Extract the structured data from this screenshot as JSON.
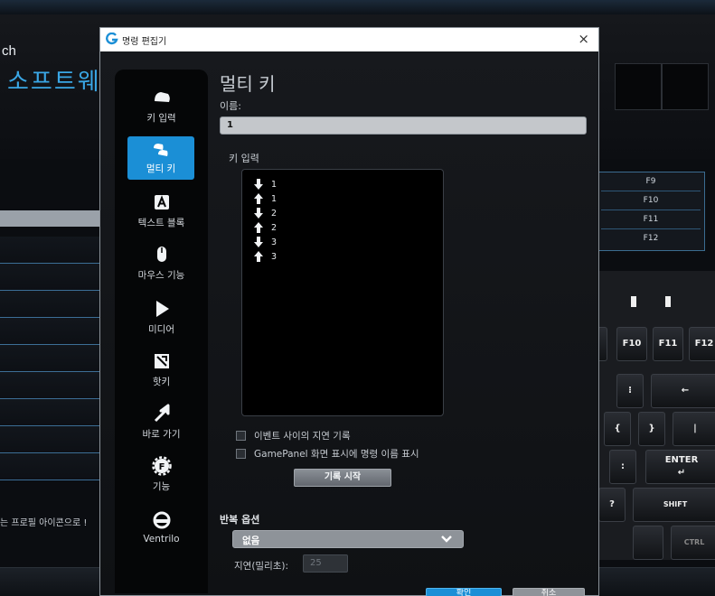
{
  "background": {
    "brand": "ch",
    "title": "소프트웨",
    "left_note": "는 프로필 아이콘으로 !",
    "fkeys": [
      "F9",
      "F10",
      "F11",
      "F12"
    ],
    "keyboard_labels": {
      "f10": "F10",
      "f11": "F11",
      "f12": "F12",
      "backspace_arrow": "←",
      "enter": "ENTER",
      "enter_arrow": "↵",
      "shift": "SHIFT",
      "ctrl": "CTRL",
      "colon": ":",
      "brace_open": "{",
      "brace_close": "}",
      "pipe": "|",
      "question": "?",
      "dots": "⁝"
    }
  },
  "dialog": {
    "title": "명령 편집기",
    "close": "×",
    "nav": [
      {
        "label": "키 입력",
        "icon": "key-icon"
      },
      {
        "label": "멀티 키",
        "icon": "multi-key-icon",
        "active": true
      },
      {
        "label": "텍스트 블록",
        "icon": "text-block-icon"
      },
      {
        "label": "마우스 기능",
        "icon": "mouse-icon"
      },
      {
        "label": "미디어",
        "icon": "play-icon"
      },
      {
        "label": "핫키",
        "icon": "hotkey-icon"
      },
      {
        "label": "바로 가기",
        "icon": "shortcut-arrow-icon"
      },
      {
        "label": "기능",
        "icon": "function-gear-icon"
      },
      {
        "label": "Ventrilo",
        "icon": "ventrilo-headset-icon"
      }
    ],
    "heading": "멀티 키",
    "name_label": "이름:",
    "name_value": "1",
    "keys_label": "키 입력",
    "key_events": [
      {
        "dir": "down",
        "key": "1"
      },
      {
        "dir": "up",
        "key": "1"
      },
      {
        "dir": "down",
        "key": "2"
      },
      {
        "dir": "up",
        "key": "2"
      },
      {
        "dir": "down",
        "key": "3"
      },
      {
        "dir": "up",
        "key": "3"
      }
    ],
    "check_delay": "이벤트 사이의 지연 기록",
    "check_gamepanel": "GamePanel 화면 표시에 명령 이름 표시",
    "record_button": "기록 시작",
    "repeat_label": "반복 옵션",
    "repeat_value": "없음",
    "delay_label": "지연(밀리초):",
    "delay_value": "25",
    "ok_button": "확인",
    "cancel_button": "취소"
  },
  "colors": {
    "accent": "#1b8fd6",
    "title_blue": "#3aa7e6"
  }
}
